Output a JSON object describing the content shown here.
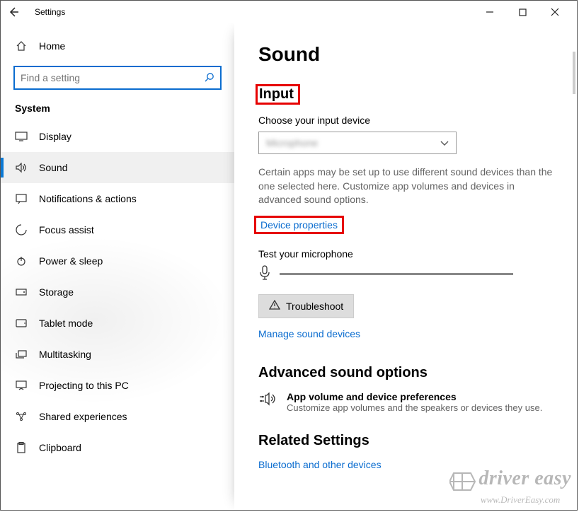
{
  "window": {
    "title": "Settings"
  },
  "sidebar": {
    "home": "Home",
    "search_placeholder": "Find a setting",
    "group": "System",
    "items": [
      {
        "label": "Display",
        "icon": "display"
      },
      {
        "label": "Sound",
        "icon": "sound"
      },
      {
        "label": "Notifications & actions",
        "icon": "notifications"
      },
      {
        "label": "Focus assist",
        "icon": "focus"
      },
      {
        "label": "Power & sleep",
        "icon": "power"
      },
      {
        "label": "Storage",
        "icon": "storage"
      },
      {
        "label": "Tablet mode",
        "icon": "tablet"
      },
      {
        "label": "Multitasking",
        "icon": "multitasking"
      },
      {
        "label": "Projecting to this PC",
        "icon": "projecting"
      },
      {
        "label": "Shared experiences",
        "icon": "shared"
      },
      {
        "label": "Clipboard",
        "icon": "clipboard"
      }
    ],
    "active_index": 1
  },
  "content": {
    "page_title": "Sound",
    "input_heading": "Input",
    "choose_label": "Choose your input device",
    "dropdown_value": "Microphone",
    "hint": "Certain apps may be set up to use different sound devices than the one selected here. Customize app volumes and devices in advanced sound options.",
    "device_properties": "Device properties",
    "test_label": "Test your microphone",
    "troubleshoot": "Troubleshoot",
    "manage_link": "Manage sound devices",
    "advanced_heading": "Advanced sound options",
    "app_vol_title": "App volume and device preferences",
    "app_vol_desc": "Customize app volumes and the speakers or devices they use.",
    "related_heading": "Related Settings",
    "bluetooth_link": "Bluetooth and other devices"
  },
  "watermark": {
    "brand": "driver easy",
    "url": "www.DriverEasy.com"
  }
}
